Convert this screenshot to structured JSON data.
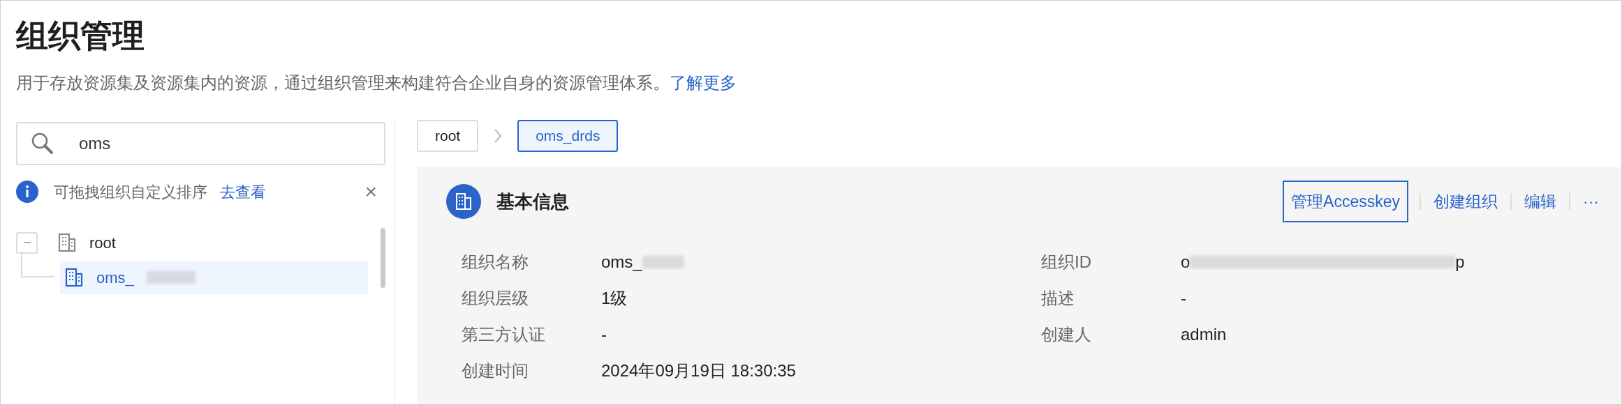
{
  "page": {
    "title": "组织管理",
    "description": "用于存放资源集及资源集内的资源，通过组织管理来构建符合企业自身的资源管理体系。",
    "learn_more_link": "了解更多"
  },
  "search": {
    "value": "oms"
  },
  "notice": {
    "text": "可拖拽组织自定义排序",
    "link": "去查看",
    "close": "×"
  },
  "tree": [
    {
      "label": "root",
      "expanded": true,
      "selected": false,
      "children": [
        {
          "label": "oms_",
          "redacted": true,
          "selected": true
        }
      ]
    }
  ],
  "breadcrumb": [
    {
      "label": "root",
      "selected": false
    },
    {
      "label": "oms_drds",
      "selected": true
    }
  ],
  "info": {
    "title": "基本信息",
    "actions": [
      {
        "label": "管理Accesskey",
        "focused": true
      },
      {
        "label": "创建组织",
        "focused": false
      },
      {
        "label": "编辑",
        "focused": false
      },
      {
        "label": "···",
        "focused": false
      }
    ],
    "fields_left": [
      {
        "label": "组织名称",
        "value": "oms_",
        "redacted": true
      },
      {
        "label": "组织层级",
        "value": "1级"
      },
      {
        "label": "第三方认证",
        "value": "-"
      },
      {
        "label": "创建时间",
        "value": "2024年09月19日 18:30:35"
      }
    ],
    "fields_right": [
      {
        "label": "组织ID",
        "value": "o",
        "redacted": true,
        "value_end": "p"
      },
      {
        "label": "描述",
        "value": "-"
      },
      {
        "label": "创建人",
        "value": "admin"
      }
    ]
  }
}
